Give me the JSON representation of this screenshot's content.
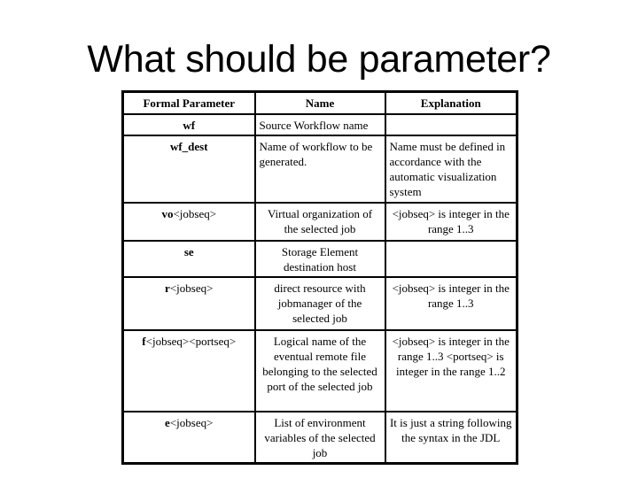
{
  "slide": {
    "title": "What should be parameter?"
  },
  "table": {
    "headers": {
      "param": "Formal Parameter",
      "name": "Name",
      "explanation": "Explanation"
    },
    "rows": [
      {
        "param_bold": "wf",
        "param_rest": "",
        "name": "Source Workflow name",
        "explanation": ""
      },
      {
        "param_bold": "wf_dest",
        "param_rest": "",
        "name": "Name of workflow to be generated.",
        "explanation": "Name must be defined in accordance with the automatic visualization system"
      },
      {
        "param_bold": "vo",
        "param_rest": "<jobseq>",
        "name": "Virtual organization of the selected job",
        "explanation": "<jobseq> is integer in the range 1..3"
      },
      {
        "param_bold": "se",
        "param_rest": "",
        "name": "Storage Element destination host",
        "explanation": ""
      },
      {
        "param_bold": "r",
        "param_rest": "<jobseq>",
        "name": "direct resource with jobmanager of the selected job",
        "explanation": "<jobseq> is integer in the range 1..3"
      },
      {
        "param_bold": "f",
        "param_rest": "<jobseq><portseq>",
        "name": "Logical name of the eventual remote file belonging to the selected port of the selected job",
        "explanation": "<jobseq> is integer in the range 1..3 <portseq> is integer in the range 1..2"
      },
      {
        "param_bold": "e",
        "param_rest": "<jobseq>",
        "name": "List of environment variables of the selected job",
        "explanation": "It is just a string following the syntax in the JDL"
      }
    ]
  }
}
